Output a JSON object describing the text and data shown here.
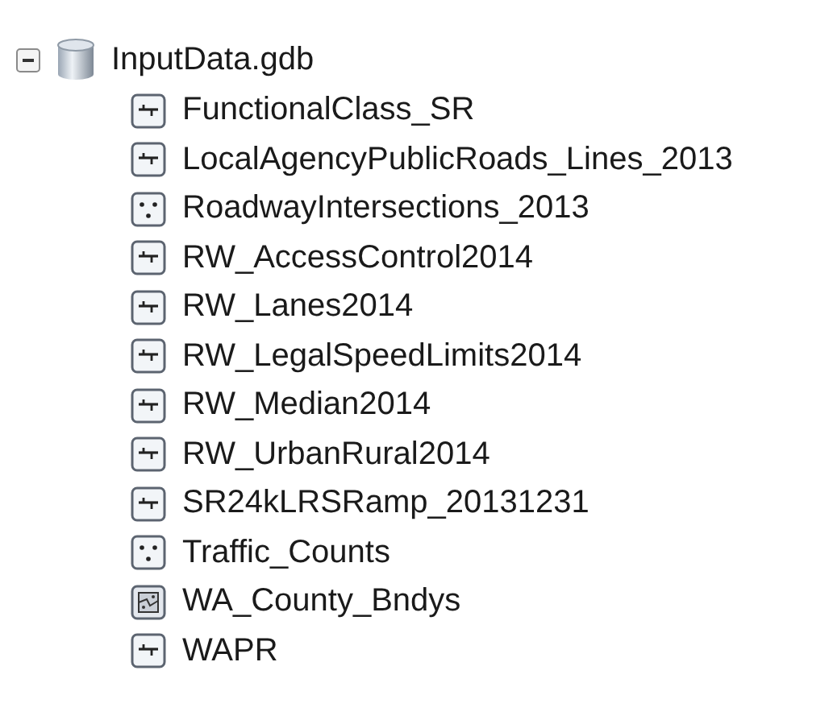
{
  "tree": {
    "label": "InputData.gdb",
    "expanded": true,
    "children": [
      {
        "label": "FunctionalClass_SR",
        "kind": "line"
      },
      {
        "label": "LocalAgencyPublicRoads_Lines_2013",
        "kind": "line"
      },
      {
        "label": "RoadwayIntersections_2013",
        "kind": "point"
      },
      {
        "label": "RW_AccessControl2014",
        "kind": "line"
      },
      {
        "label": "RW_Lanes2014",
        "kind": "line"
      },
      {
        "label": "RW_LegalSpeedLimits2014",
        "kind": "line"
      },
      {
        "label": "RW_Median2014",
        "kind": "line"
      },
      {
        "label": "RW_UrbanRural2014",
        "kind": "line"
      },
      {
        "label": "SR24kLRSRamp_20131231",
        "kind": "line"
      },
      {
        "label": "Traffic_Counts",
        "kind": "point"
      },
      {
        "label": "WA_County_Bndys",
        "kind": "polygon"
      },
      {
        "label": "WAPR",
        "kind": "line"
      }
    ]
  }
}
